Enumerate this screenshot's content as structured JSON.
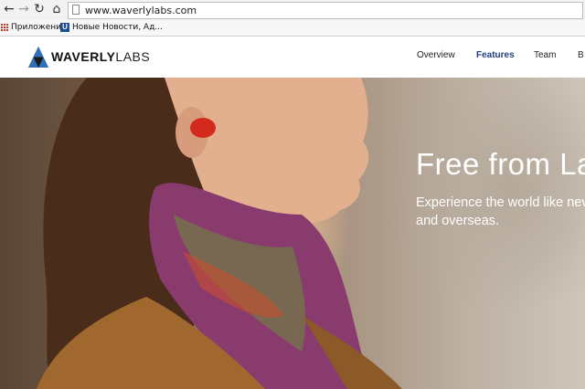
{
  "browser": {
    "back_icon": "back-arrow-icon",
    "forward_icon": "forward-arrow-icon",
    "reload_icon": "reload-icon",
    "home_icon": "home-icon",
    "url": "www.waverlylabs.com"
  },
  "bookmarks": {
    "apps_label": "Приложения",
    "news_label": "Новые Новости, Ад..."
  },
  "site": {
    "logo_bold": "WAVERLY",
    "logo_light": "LABS",
    "nav": {
      "overview": "Overview",
      "features": "Features",
      "team": "Team",
      "cut": "B"
    }
  },
  "hero": {
    "headline": "Free from Lan",
    "subline_1": "Experience the world like neve",
    "subline_2": "and overseas."
  },
  "colors": {
    "nav_active": "#1f3f82",
    "logo_blue": "#2f6fb7",
    "logo_dark": "#1a1a1a",
    "earpiece_red": "#d42a1e"
  }
}
